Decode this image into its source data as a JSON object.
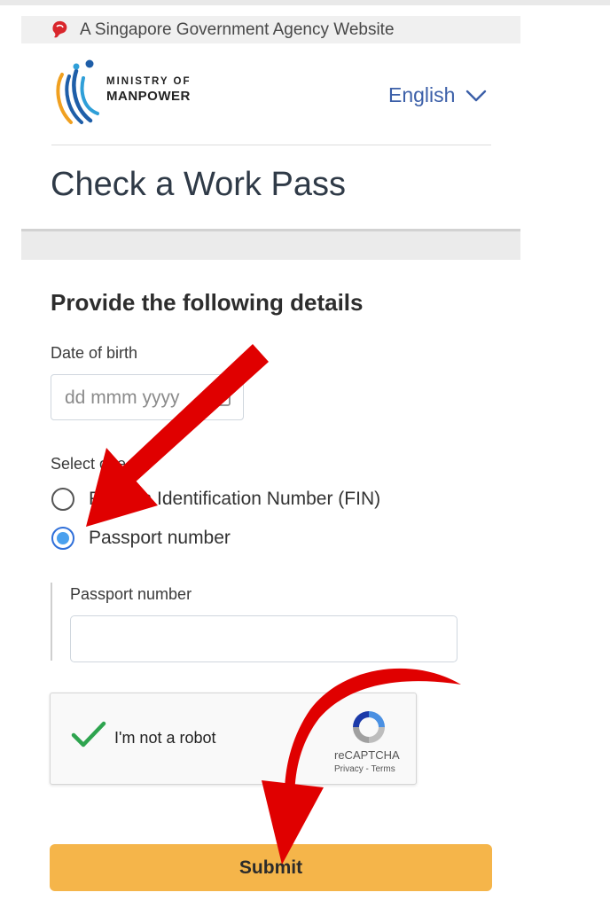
{
  "masthead": {
    "text": "A Singapore Government Agency Website"
  },
  "logo": {
    "line1": "MINISTRY OF",
    "line2": "MANPOWER"
  },
  "language": {
    "selected": "English"
  },
  "page": {
    "title": "Check a Work Pass"
  },
  "form": {
    "heading": "Provide the following details",
    "dob_label": "Date of birth",
    "dob_placeholder": "dd mmm yyyy",
    "select_label": "Select one",
    "options": [
      {
        "label": "Foreign Identification Number (FIN)",
        "checked": false
      },
      {
        "label": "Passport number",
        "checked": true
      }
    ],
    "passport_label": "Passport number",
    "passport_value": ""
  },
  "captcha": {
    "label": "I'm not a robot",
    "brand": "reCAPTCHA",
    "links": "Privacy - Terms",
    "checked": true
  },
  "submit": {
    "label": "Submit"
  },
  "colors": {
    "link_blue": "#3b5fa8",
    "submit_bg": "#f5b54a",
    "radio_blue": "#4aa0ee",
    "annotation_red": "#e00000",
    "check_green": "#2ea44f"
  }
}
